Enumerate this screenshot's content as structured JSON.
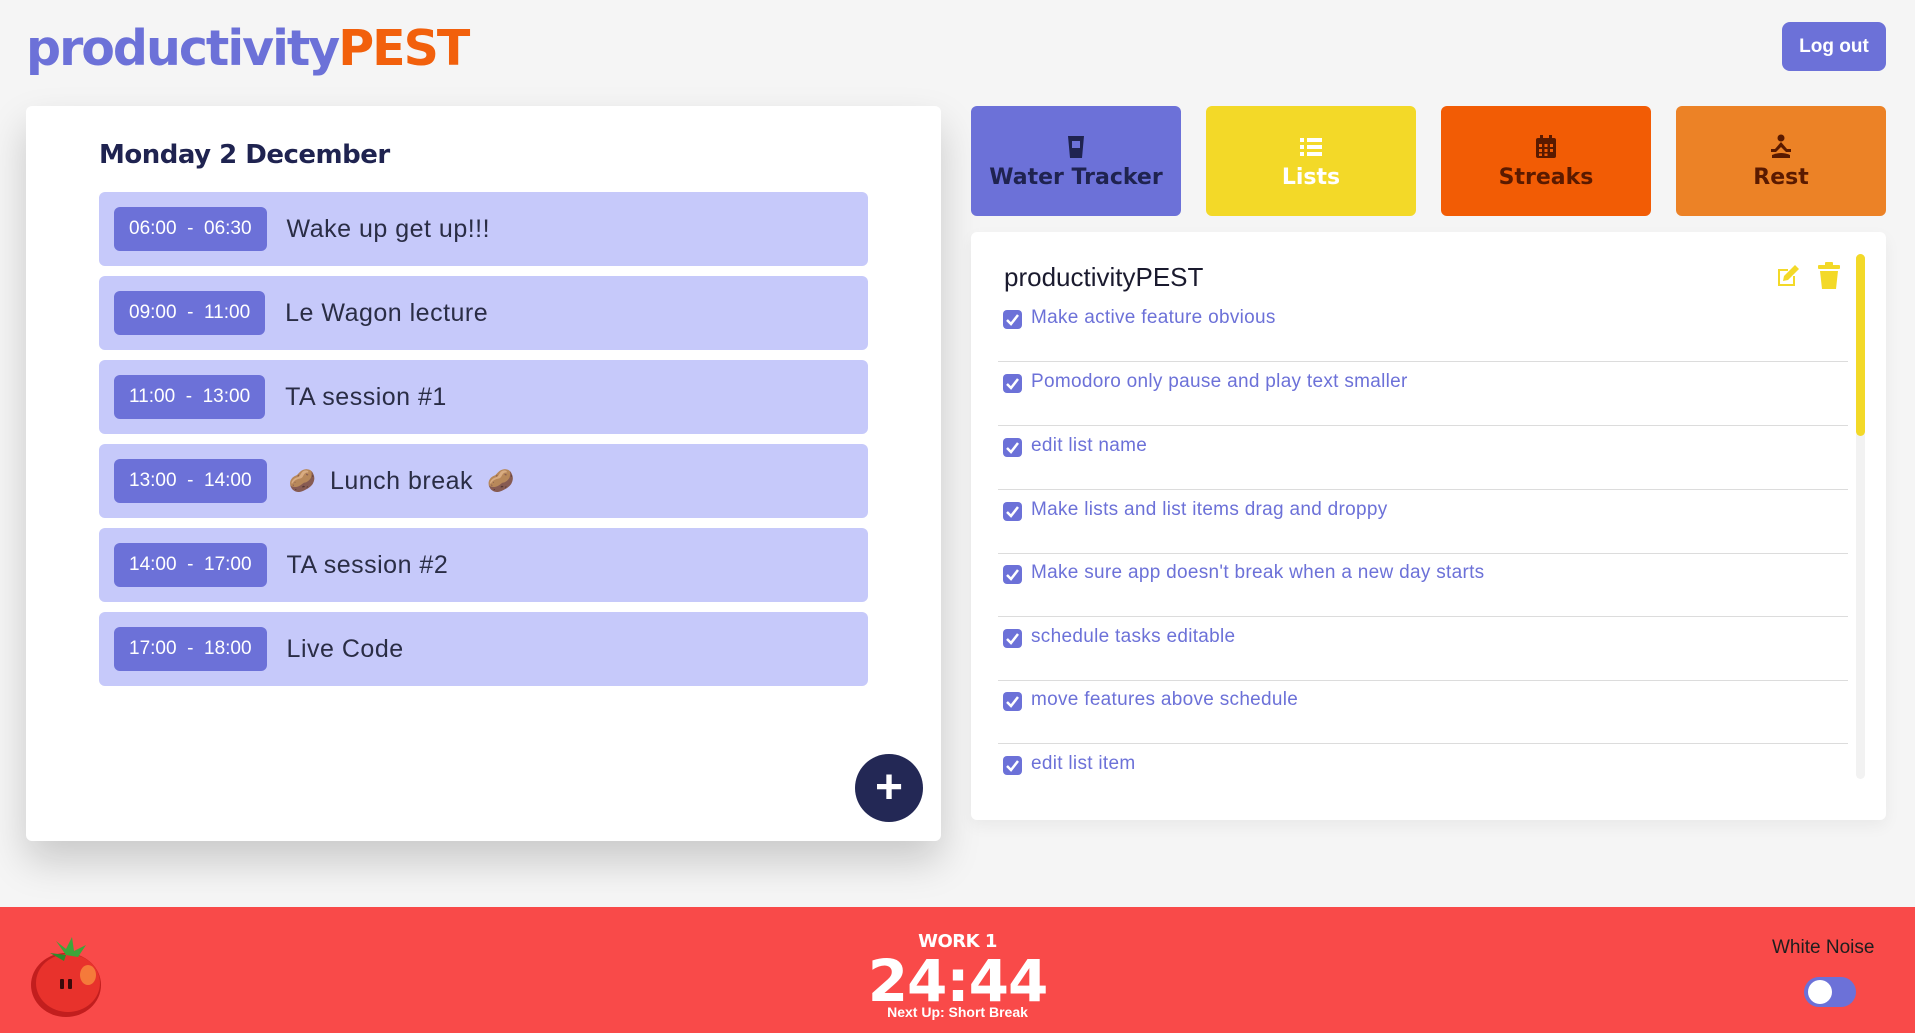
{
  "header": {
    "logo_part1": "productivity",
    "logo_part2": "PEST",
    "logout_label": "Log out"
  },
  "schedule": {
    "date": "Monday 2 December",
    "slots": [
      {
        "start": "06:00",
        "end": "06:30",
        "title": "Wake up get up!!!"
      },
      {
        "start": "09:00",
        "end": "11:00",
        "title": "Le Wagon lecture"
      },
      {
        "start": "11:00",
        "end": "13:00",
        "title": "TA session #1"
      },
      {
        "start": "13:00",
        "end": "14:00",
        "title": "Lunch break",
        "emoji": "🥔"
      },
      {
        "start": "14:00",
        "end": "17:00",
        "title": "TA session #2"
      },
      {
        "start": "17:00",
        "end": "18:00",
        "title": "Live Code"
      }
    ],
    "add_label": "+"
  },
  "tabs": [
    {
      "label": "Water Tracker",
      "icon": "glass-icon",
      "color": "#6c71d8"
    },
    {
      "label": "Lists",
      "icon": "list-icon",
      "color": "#f3d928"
    },
    {
      "label": "Streaks",
      "icon": "calendar-icon",
      "color": "#f25c05"
    },
    {
      "label": "Rest",
      "icon": "meditation-icon",
      "color": "#ec8226"
    }
  ],
  "list": {
    "title": "productivityPEST",
    "items": [
      {
        "text": "Make active feature obvious",
        "checked": true
      },
      {
        "text": "Pomodoro only pause and play text smaller",
        "checked": true
      },
      {
        "text": "edit list name",
        "checked": true
      },
      {
        "text": "Make lists and list items drag and droppy",
        "checked": true
      },
      {
        "text": "Make sure app doesn't break when a new day starts",
        "checked": true
      },
      {
        "text": "schedule tasks editable",
        "checked": true
      },
      {
        "text": "move features above schedule",
        "checked": true
      },
      {
        "text": "edit list item",
        "checked": true
      }
    ]
  },
  "pomodoro": {
    "label": "WORK 1",
    "time": "24:44",
    "next": "Next Up: Short Break"
  },
  "white_noise": {
    "label": "White Noise",
    "enabled": false
  },
  "colors": {
    "primary": "#6c71d8",
    "yellow": "#f3d928",
    "orange": "#f25c05",
    "footer": "#f94a49"
  }
}
